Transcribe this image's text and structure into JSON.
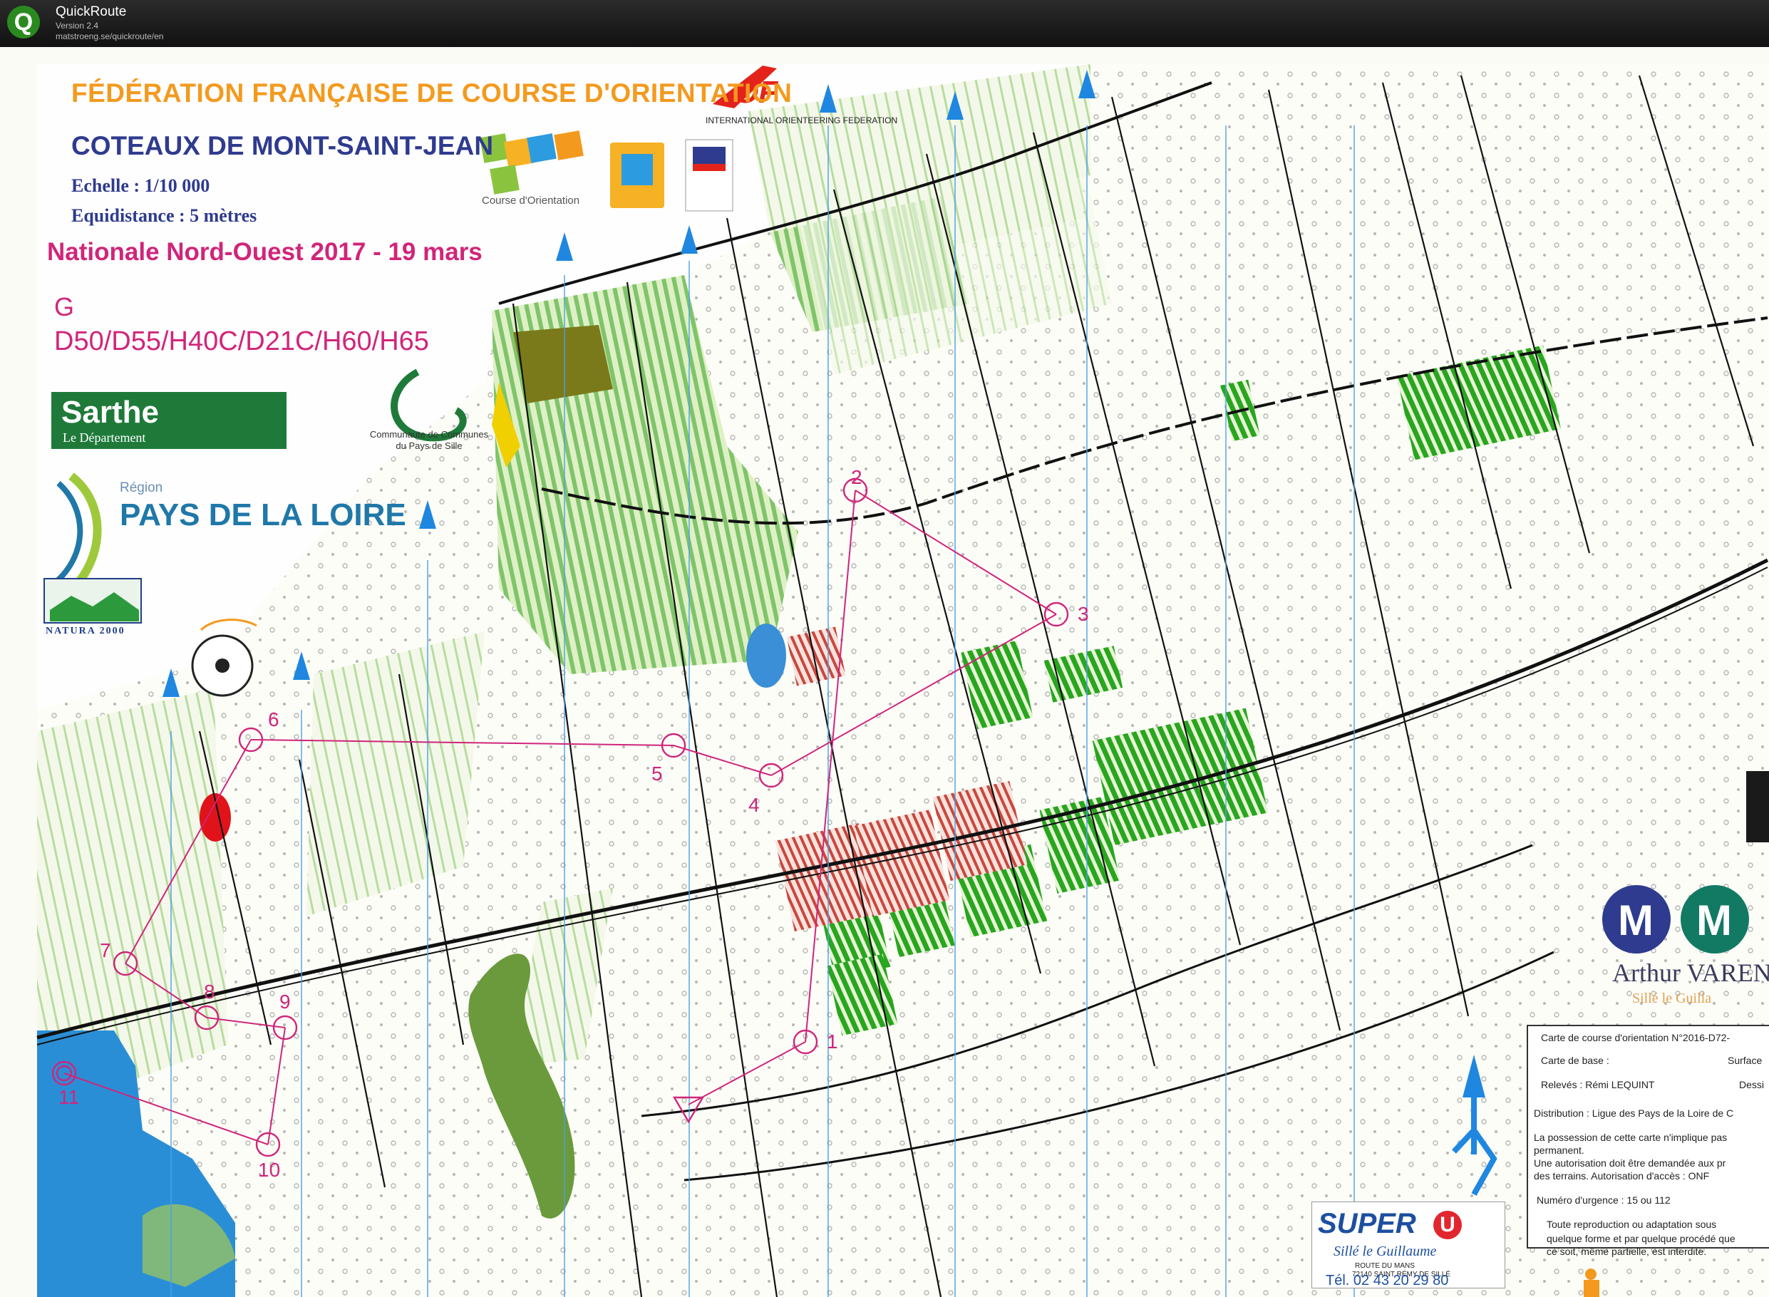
{
  "window": {
    "app_name": "QuickRoute",
    "version": "Version 2.4",
    "url": "matstroeng.se/quickroute/en"
  },
  "header": {
    "federation": "FÉDÉRATION FRANÇAISE DE COURSE D'ORIENTATION",
    "iof_name": "INTERNATIONAL ORIENTEERING FEDERATION",
    "map_name": "COTEAUX DE MONT-SAINT-JEAN",
    "scale": "Echelle : 1/10 000",
    "equidistance": "Equidistance : 5 mètres",
    "event": "Nationale Nord-Ouest 2017 - 19 mars",
    "course": "G",
    "classes": "D50/D55/H40C/D21C/H60/H65"
  },
  "logos": {
    "sarthe_name": "Sarthe",
    "sarthe_sub": "Le Département",
    "ccps": "Communaute de Communes du Pays de Sille",
    "region_label": "Région",
    "region_name": "PAYS DE LA LOIRE",
    "natura": "NATURA 2000"
  },
  "controls": [
    {
      "label": "1"
    },
    {
      "label": "2"
    },
    {
      "label": "3"
    },
    {
      "label": "4"
    },
    {
      "label": "5"
    },
    {
      "label": "6"
    },
    {
      "label": "7"
    },
    {
      "label": "8"
    },
    {
      "label": "9"
    },
    {
      "label": "10"
    },
    {
      "label": "11"
    }
  ],
  "sponsor": {
    "name": "Arthur VAREN",
    "town": "Sillé le Guilla"
  },
  "info": {
    "line1": "Carte de course d'orientation N°2016-D72-",
    "line2": "Carte de base :",
    "line2b": "Surface",
    "line3": "Relevés : Rémi LEQUINT",
    "line3b": "Dessi",
    "line4": "Distribution : Ligue des Pays de la Loire de C",
    "line5": "La possession de cette carte n'implique pas",
    "line6": "permanent.",
    "line7": "Une autorisation doit être demandée aux pr",
    "line8": "des terrains.     Autorisation d'accès : ONF",
    "line9": "Numéro d'urgence : 15 ou 112",
    "line10": "Toute reproduction ou adaptation sous",
    "line11": "quelque forme et par quelque procédé que",
    "line12": "ce soit, même partielle, est interdite."
  },
  "super_u": {
    "name": "SUPER",
    "u": "U",
    "town": "Sillé le Guillaume",
    "addr1": "ROUTE DU MANS",
    "addr2": "72140 SAINT RÉMY DE SILLÉ",
    "tel": "Tél. 02 43 20 29 80"
  }
}
